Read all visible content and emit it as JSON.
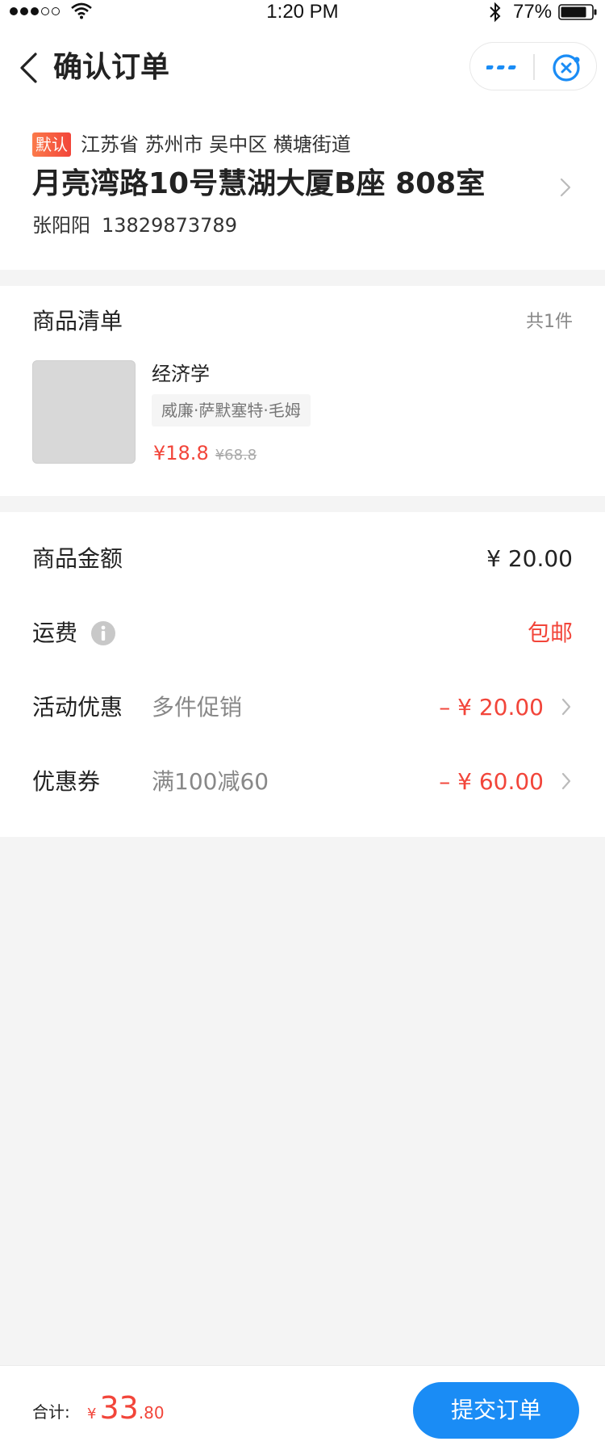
{
  "status_bar": {
    "time": "1:20 PM",
    "battery": "77%",
    "icons": [
      "signal-icon",
      "wifi-icon",
      "bluetooth-icon",
      "battery-icon"
    ]
  },
  "header": {
    "title": "确认订单",
    "icons": [
      "back-icon",
      "more-icon",
      "close-circle-icon"
    ],
    "accent_color": "#1a8cf5"
  },
  "address": {
    "badge": "默认",
    "region": "江苏省 苏州市 吴中区 横塘街道",
    "detail": "月亮湾路10号慧湖大厦B座 808室",
    "name": "张阳阳",
    "phone": "13829873789"
  },
  "goods": {
    "title": "商品清单",
    "count": "共1件",
    "items": [
      {
        "name": "经济学",
        "author": "威廉·萨默塞特·毛姆",
        "price": "¥18.8",
        "original_price": "¥68.8"
      }
    ]
  },
  "summary": {
    "goods_amount": {
      "label": "商品金额",
      "value": "¥ 20.00"
    },
    "shipping": {
      "label": "运费",
      "value": "包邮"
    },
    "promotion": {
      "label": "活动优惠",
      "desc": "多件促销",
      "value": "– ¥ 20.00"
    },
    "coupon": {
      "label": "优惠券",
      "desc": "满100减60",
      "value": "– ¥ 60.00"
    }
  },
  "footer": {
    "total_label": "合计:",
    "currency": "¥",
    "total_integer": "33",
    "total_decimal": ".80",
    "submit_label": "提交订单"
  },
  "colors": {
    "price_red": "#f2453a",
    "primary_blue": "#1a8cf5",
    "background": "#f4f4f4"
  }
}
